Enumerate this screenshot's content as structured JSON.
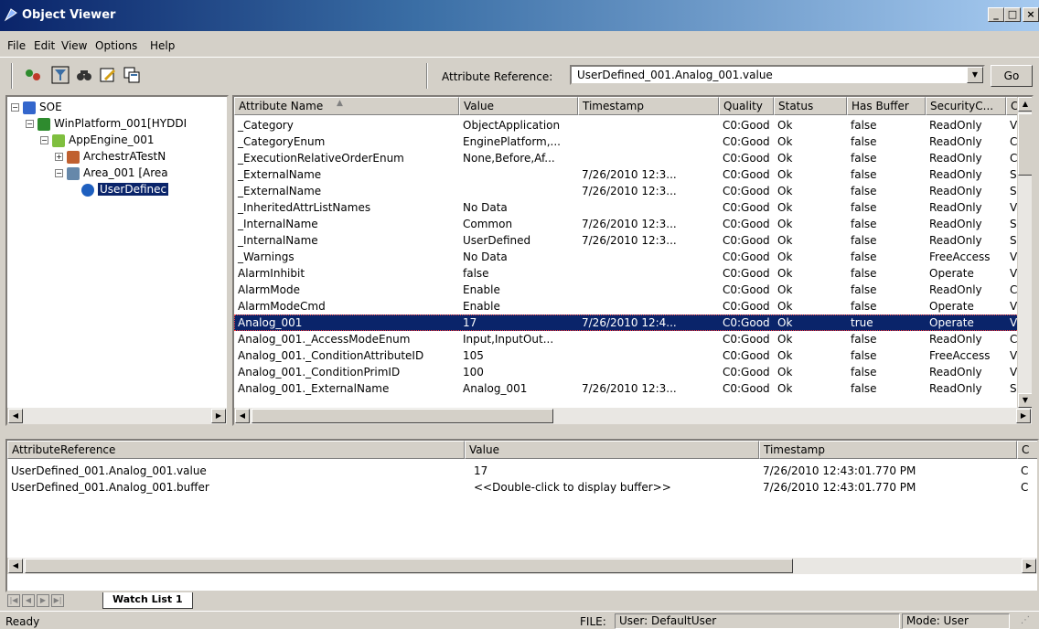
{
  "window": {
    "title": "Object Viewer"
  },
  "menu": [
    "File",
    "Edit",
    "View",
    "Options",
    "Help"
  ],
  "toolbar": {
    "attr_ref_label": "Attribute Reference:",
    "attr_ref_value": "UserDefined_001.Analog_001.value",
    "go_label": "Go"
  },
  "tree": [
    {
      "label": "SOE",
      "depth": 0,
      "expander": "−",
      "icon": "galaxy-icon"
    },
    {
      "label": "WinPlatform_001[HYDDI",
      "depth": 1,
      "expander": "−",
      "icon": "platform-icon"
    },
    {
      "label": "AppEngine_001",
      "depth": 2,
      "expander": "−",
      "icon": "engine-icon"
    },
    {
      "label": "ArchestrATestN",
      "depth": 3,
      "expander": "+",
      "icon": "object-icon"
    },
    {
      "label": "Area_001 [Area",
      "depth": 3,
      "expander": "−",
      "icon": "area-icon"
    },
    {
      "label": "UserDefinec",
      "depth": 4,
      "expander": "",
      "icon": "userdefined-icon",
      "selected": true
    }
  ],
  "grid": {
    "columns": [
      "Attribute Name",
      "Value",
      "Timestamp",
      "Quality",
      "Status",
      "Has Buffer",
      "SecurityC...",
      "C"
    ],
    "rows": [
      [
        "_Category",
        "ObjectApplication",
        "",
        "C0:Good",
        "Ok",
        "false",
        "ReadOnly",
        "V"
      ],
      [
        "_CategoryEnum",
        "EnginePlatform,...",
        "",
        "C0:Good",
        "Ok",
        "false",
        "ReadOnly",
        "C"
      ],
      [
        "_ExecutionRelativeOrderEnum",
        "None,Before,Af...",
        "",
        "C0:Good",
        "Ok",
        "false",
        "ReadOnly",
        "C"
      ],
      [
        "_ExternalName",
        "",
        "7/26/2010 12:3...",
        "C0:Good",
        "Ok",
        "false",
        "ReadOnly",
        "S"
      ],
      [
        "_ExternalName",
        "",
        "7/26/2010 12:3...",
        "C0:Good",
        "Ok",
        "false",
        "ReadOnly",
        "S"
      ],
      [
        "_InheritedAttrListNames",
        "No Data",
        "",
        "C0:Good",
        "Ok",
        "false",
        "ReadOnly",
        "V"
      ],
      [
        "_InternalName",
        "Common",
        "7/26/2010 12:3...",
        "C0:Good",
        "Ok",
        "false",
        "ReadOnly",
        "S"
      ],
      [
        "_InternalName",
        "UserDefined",
        "7/26/2010 12:3...",
        "C0:Good",
        "Ok",
        "false",
        "ReadOnly",
        "S"
      ],
      [
        "_Warnings",
        "No Data",
        "",
        "C0:Good",
        "Ok",
        "false",
        "FreeAccess",
        "V"
      ],
      [
        "AlarmInhibit",
        "false",
        "",
        "C0:Good",
        "Ok",
        "false",
        "Operate",
        "V"
      ],
      [
        "AlarmMode",
        "Enable",
        "",
        "C0:Good",
        "Ok",
        "false",
        "ReadOnly",
        "C"
      ],
      [
        "AlarmModeCmd",
        "Enable",
        "",
        "C0:Good",
        "Ok",
        "false",
        "Operate",
        "V"
      ],
      [
        "Analog_001",
        "17",
        "7/26/2010 12:4...",
        "C0:Good",
        "Ok",
        "true",
        "Operate",
        "V"
      ],
      [
        "Analog_001._AccessModeEnum",
        "Input,InputOut...",
        "",
        "C0:Good",
        "Ok",
        "false",
        "ReadOnly",
        "C"
      ],
      [
        "Analog_001._ConditionAttributeID",
        "105",
        "",
        "C0:Good",
        "Ok",
        "false",
        "FreeAccess",
        "V"
      ],
      [
        "Analog_001._ConditionPrimID",
        "100",
        "",
        "C0:Good",
        "Ok",
        "false",
        "ReadOnly",
        "V"
      ],
      [
        "Analog_001._ExternalName",
        "Analog_001",
        "7/26/2010 12:3...",
        "C0:Good",
        "Ok",
        "false",
        "ReadOnly",
        "S"
      ]
    ],
    "selected_row": 12
  },
  "watch": {
    "columns": [
      "AttributeReference",
      "Value",
      "Timestamp",
      "C"
    ],
    "rows": [
      [
        "UserDefined_001.Analog_001.value",
        "17",
        "7/26/2010 12:43:01.770 PM",
        "C"
      ],
      [
        "UserDefined_001.Analog_001.buffer",
        "<<Double-click to display buffer>>",
        "7/26/2010 12:43:01.770 PM",
        "C"
      ]
    ]
  },
  "tabs": {
    "watch_list": "Watch List 1"
  },
  "status": {
    "left": "Ready",
    "file": "FILE:",
    "user": "User: DefaultUser",
    "mode": "Mode: User"
  },
  "colors": {
    "selection": "#0a246a",
    "chrome": "#d4d0c8",
    "title_start": "#0a246a"
  }
}
